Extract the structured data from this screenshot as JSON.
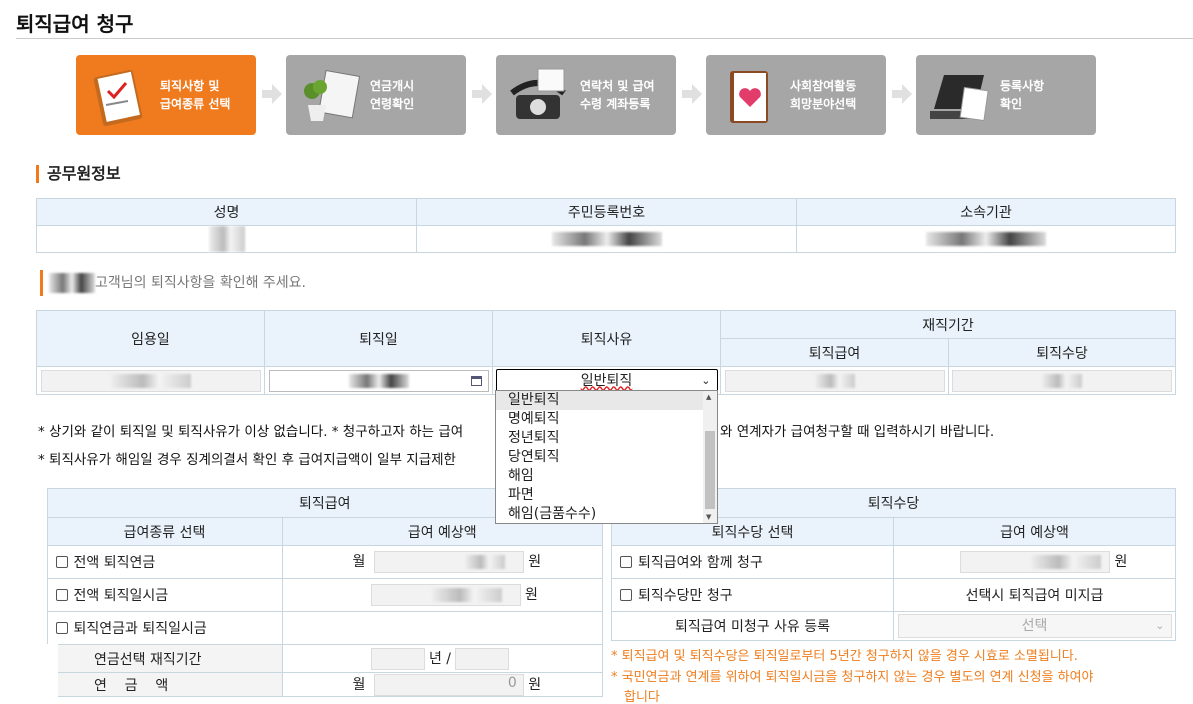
{
  "page": {
    "title": "퇴직급여 청구"
  },
  "steps": [
    {
      "line1": "퇴직사항 및",
      "line2": "급여종류 선택"
    },
    {
      "line1": "연금개시",
      "line2": "연령확인"
    },
    {
      "line1": "연락처 및 급여",
      "line2": "수령 계좌등록"
    },
    {
      "line1": "사회참여활동",
      "line2": "희망분야선택"
    },
    {
      "line1": "등록사항",
      "line2": "확인"
    }
  ],
  "officer": {
    "section_title": "공무원정보",
    "headers": [
      "성명",
      "주민등록번호",
      "소속기관"
    ]
  },
  "retire": {
    "greeting_suffix": "고객님의 퇴직사항을 확인해 주세요.",
    "headers": {
      "appoint": "임용일",
      "retire": "퇴직일",
      "reason": "퇴직사유",
      "tenure": "재직기간",
      "tenure_benefit": "퇴직급여",
      "tenure_allowance": "퇴직수당"
    },
    "reason_selected": "일반퇴직",
    "reason_options": [
      "일반퇴직",
      "명예퇴직",
      "정년퇴직",
      "당연퇴직",
      "해임",
      "파면",
      "해임(금품수수)"
    ]
  },
  "notes": {
    "line1_a": "* 상기와 같이 퇴직일 및 퇴직사유가 이상 없습니다. * 청구하고자 하는 급여",
    "line1_b": "와 연계자가 급여청구할 때 입력하시기 바랍니다.",
    "line2": "* 퇴직사유가 해임일 경우 징계의결서 확인 후 급여지급액이 일부 지급제한"
  },
  "benefit": {
    "title": "퇴직급여",
    "col_type": "급여종류 선택",
    "col_amount": "급여 예상액",
    "opt1": "전액 퇴직연금",
    "opt2": "전액 퇴직일시금",
    "opt3": "퇴직연금과 퇴직일시금",
    "month": "월",
    "won": "원",
    "pension_period_label": "연금선택 재직기간",
    "year_sep": "년 /",
    "pension_amount_label": "연    금    액",
    "pension_amount_value": "0"
  },
  "allowance": {
    "title": "퇴직수당",
    "col_type": "퇴직수당 선택",
    "col_amount": "급여 예상액",
    "opt1": "퇴직급여와 함께 청구",
    "opt2": "퇴직수당만 청구",
    "opt2_note": "선택시 퇴직급여 미지급",
    "unclaimed_label": "퇴직급여 미청구 사유 등록",
    "unclaimed_select": "선택",
    "won": "원"
  },
  "warnings": {
    "w1": "* 퇴직급여 및 퇴직수당은 퇴직일로부터 5년간 청구하지 않을 경우 시효로 소멸됩니다.",
    "w2": "* 국민연금과 연계를 위하여 퇴직일시금을 청구하지 않는 경우 별도의 연계 신청을 하여야",
    "w3": "합니다"
  },
  "colors": {
    "accent": "#f07a1e",
    "step_inactive": "#a6a6a6",
    "header_bg": "#eaf3fb",
    "border_blue": "#4f8fbf"
  }
}
